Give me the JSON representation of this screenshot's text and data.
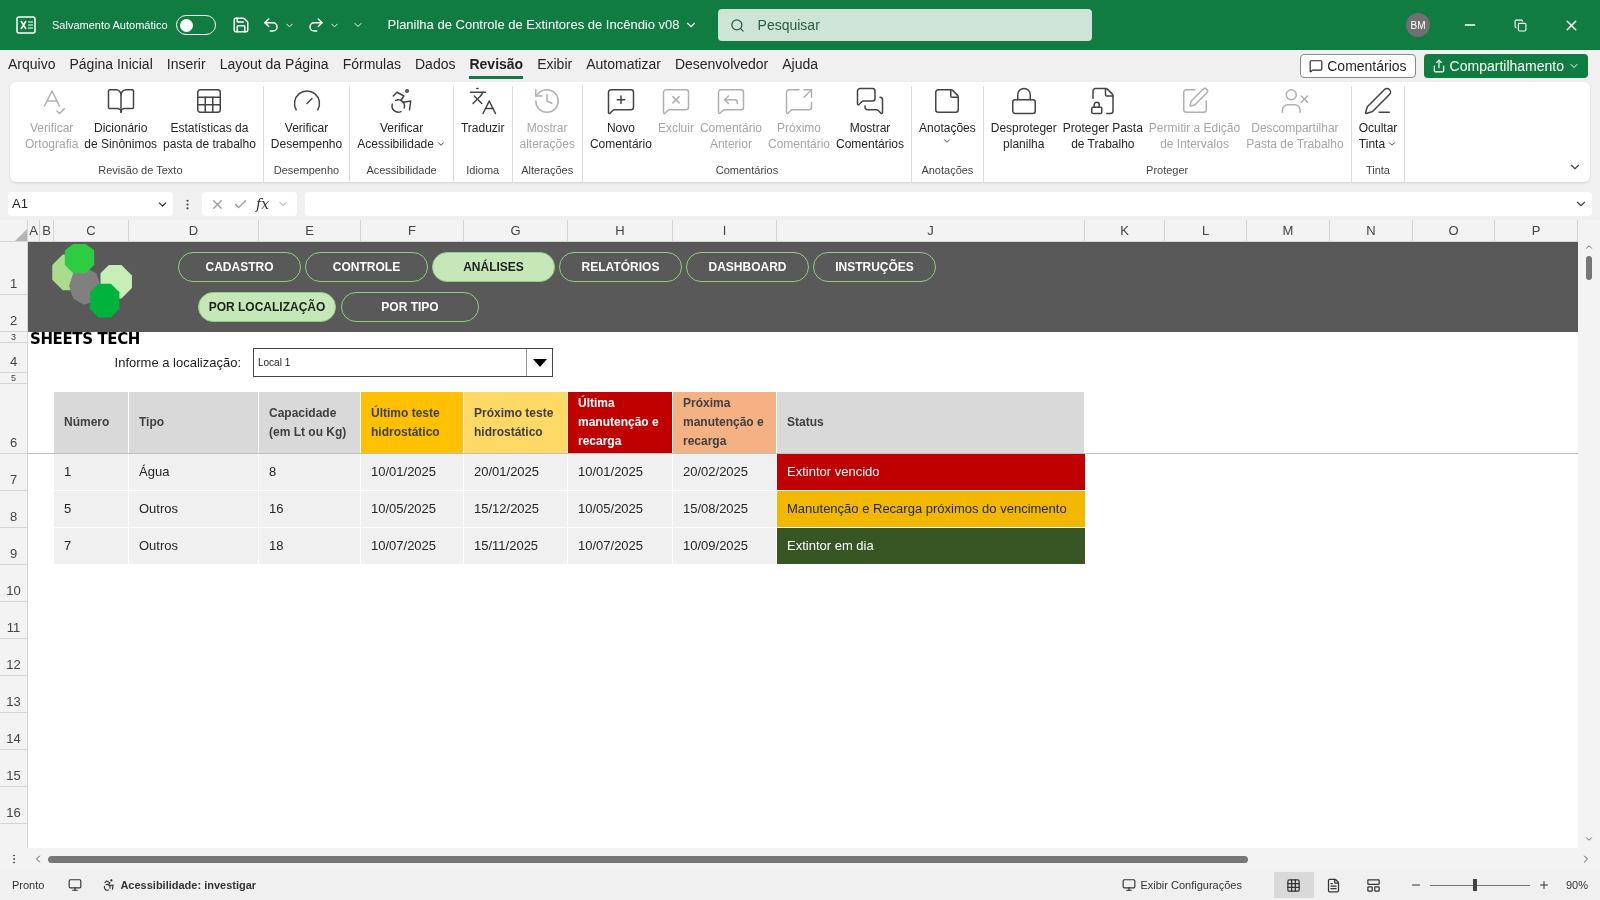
{
  "title_bar": {
    "autosave_label": "Salvamento Automático",
    "autosave_on": false,
    "document_title": "Planilha de Controle de Extintores de Incêndio v08",
    "search_placeholder": "Pesquisar",
    "user_initials": "BM"
  },
  "menu_tabs": [
    {
      "label": "Arquivo",
      "selected": false
    },
    {
      "label": "Página Inicial",
      "selected": false
    },
    {
      "label": "Inserir",
      "selected": false
    },
    {
      "label": "Layout da Página",
      "selected": false
    },
    {
      "label": "Fórmulas",
      "selected": false
    },
    {
      "label": "Dados",
      "selected": false
    },
    {
      "label": "Revisão",
      "selected": true
    },
    {
      "label": "Exibir",
      "selected": false
    },
    {
      "label": "Automatizar",
      "selected": false
    },
    {
      "label": "Desenvolvedor",
      "selected": false
    },
    {
      "label": "Ajuda",
      "selected": false
    }
  ],
  "header_actions": {
    "comments": "Comentários",
    "share": "Compartilhamento"
  },
  "ribbon_groups": [
    {
      "label": "Revisão de Texto",
      "items": [
        {
          "lines": [
            "Verificar",
            "Ortografia"
          ],
          "disabled": true,
          "dropdown": false
        },
        {
          "lines": [
            "Dicionário",
            "de Sinônimos"
          ],
          "disabled": false,
          "dropdown": false
        },
        {
          "lines": [
            "Estatísticas da",
            "pasta de trabalho"
          ],
          "disabled": false,
          "dropdown": false
        }
      ]
    },
    {
      "label": "Desempenho",
      "items": [
        {
          "lines": [
            "Verificar",
            "Desempenho"
          ],
          "disabled": false,
          "dropdown": false
        }
      ]
    },
    {
      "label": "Acessibilidade",
      "items": [
        {
          "lines": [
            "Verificar",
            "Acessibilidade"
          ],
          "disabled": false,
          "dropdown": true
        }
      ]
    },
    {
      "label": "Idioma",
      "items": [
        {
          "lines": [
            "Traduzir"
          ],
          "disabled": false,
          "dropdown": false
        }
      ]
    },
    {
      "label": "Alterações",
      "items": [
        {
          "lines": [
            "Mostrar",
            "alterações"
          ],
          "disabled": true,
          "dropdown": false
        }
      ]
    },
    {
      "label": "Comentários",
      "items": [
        {
          "lines": [
            "Novo",
            "Comentário"
          ],
          "disabled": false,
          "dropdown": false
        },
        {
          "lines": [
            "Excluir"
          ],
          "disabled": true,
          "dropdown": false
        },
        {
          "lines": [
            "Comentário",
            "Anterior"
          ],
          "disabled": true,
          "dropdown": false
        },
        {
          "lines": [
            "Próximo",
            "Comentário"
          ],
          "disabled": true,
          "dropdown": false
        },
        {
          "lines": [
            "Mostrar",
            "Comentários"
          ],
          "disabled": false,
          "dropdown": false
        }
      ]
    },
    {
      "label": "Anotações",
      "items": [
        {
          "lines": [
            "Anotações"
          ],
          "disabled": false,
          "dropdown": true
        }
      ]
    },
    {
      "label": "Proteger",
      "items": [
        {
          "lines": [
            "Desproteger",
            "planilha"
          ],
          "disabled": false,
          "dropdown": false
        },
        {
          "lines": [
            "Proteger Pasta",
            "de Trabalho"
          ],
          "disabled": false,
          "dropdown": false
        },
        {
          "lines": [
            "Permitir a Edição",
            "de Intervalos"
          ],
          "disabled": true,
          "dropdown": false
        },
        {
          "lines": [
            "Descompartilhar",
            "Pasta de Trabalho"
          ],
          "disabled": true,
          "dropdown": false
        }
      ]
    },
    {
      "label": "Tinta",
      "items": [
        {
          "lines": [
            "Ocultar",
            "Tinta"
          ],
          "disabled": false,
          "dropdown": true
        }
      ]
    }
  ],
  "formula_bar": {
    "name_box": "A1",
    "function_symbol": "fx"
  },
  "column_headers": [
    "A",
    "B",
    "C",
    "D",
    "E",
    "F",
    "G",
    "H",
    "I",
    "J",
    "K",
    "L",
    "M",
    "N",
    "O",
    "P"
  ],
  "row_numbers": [
    "1",
    "2",
    "3",
    "4",
    "5",
    "6",
    "7",
    "8",
    "9",
    "10",
    "11",
    "12",
    "13",
    "14",
    "15",
    "16"
  ],
  "sheet": {
    "nav_tabs": [
      {
        "label": "CADASTRO",
        "selected": false
      },
      {
        "label": "CONTROLE",
        "selected": false
      },
      {
        "label": "ANÁLISES",
        "selected": true
      },
      {
        "label": "RELATÓRIOS",
        "selected": false
      },
      {
        "label": "DASHBOARD",
        "selected": false
      },
      {
        "label": "INSTRUÇÕES",
        "selected": false
      }
    ],
    "sub_tabs": [
      {
        "label": "POR LOCALIZAÇÃO",
        "selected": true
      },
      {
        "label": "POR TIPO",
        "selected": false
      }
    ],
    "brand": "SHEETS TECH",
    "location_label": "Informe a localização:",
    "location_value": "Local 1"
  },
  "table": {
    "columns": [
      {
        "label": "Número",
        "color": "#d9d9d9"
      },
      {
        "label": "Tipo",
        "color": "#d9d9d9"
      },
      {
        "label": "Capacidade (em Lt ou Kg)",
        "color": "#d9d9d9"
      },
      {
        "label": "Último teste hidrostático",
        "color": "#ffc000"
      },
      {
        "label": "Próximo teste hidrostático",
        "color": "#ffd966"
      },
      {
        "label": "Última manutenção e recarga",
        "color": "#c00000"
      },
      {
        "label": "Próxima manutenção e recarga",
        "color": "#f4b183"
      },
      {
        "label": "Status",
        "color": "#d9d9d9"
      }
    ],
    "rows": [
      {
        "cells": [
          "1",
          "Água",
          "8",
          "10/01/2025",
          "20/01/2025",
          "10/01/2025",
          "20/02/2025"
        ],
        "status": {
          "text": "Extintor vencido",
          "color": "#c00000"
        }
      },
      {
        "cells": [
          "5",
          "Outros",
          "16",
          "10/05/2025",
          "15/12/2025",
          "10/05/2025",
          "15/08/2025"
        ],
        "status": {
          "text": "Manutenção e Recarga próximos do vencimento",
          "color": "#f2b800"
        }
      },
      {
        "cells": [
          "7",
          "Outros",
          "18",
          "10/07/2025",
          "15/11/2025",
          "10/07/2025",
          "10/09/2025"
        ],
        "status": {
          "text": "Extintor em dia",
          "color": "#375623"
        }
      }
    ]
  },
  "status_bar": {
    "ready": "Pronto",
    "accessibility": "Acessibilidade: investigar",
    "display_settings": "Exibir Configurações",
    "views": [
      {
        "selected": true
      },
      {
        "selected": false
      },
      {
        "selected": false
      }
    ],
    "zoom_slider": {
      "level": 0.45
    },
    "zoom_label": "90%"
  }
}
